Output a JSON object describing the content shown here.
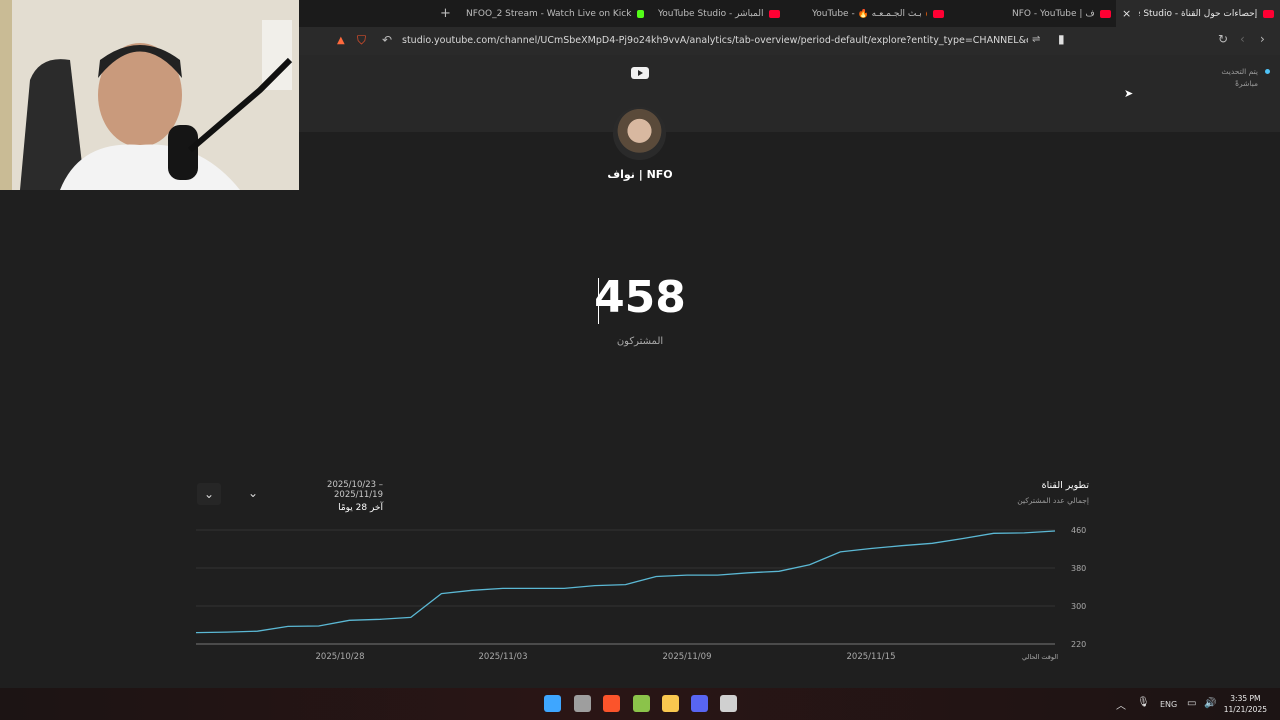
{
  "browser": {
    "tabs": [
      {
        "title": "NFOO_2 Stream - Watch Live on Kick",
        "fav_color": "#53fc18"
      },
      {
        "title": "YouTube Studio - البث المباشر",
        "fav_color": "#ff0033"
      },
      {
        "title": "YouTube - 🔥 بـث الجـمـعـه 🔥",
        "fav_color": "#ff0033"
      },
      {
        "title": "NFO - YouTube | نواف",
        "fav_color": "#ff0033"
      },
      {
        "title": "إحصاءات حول القناة - YouTube Studio",
        "fav_color": "#ff0033"
      }
    ],
    "new_tab_label": "+",
    "close_tab_label": "×",
    "url": "studio.youtube.com/channel/UCmSbeXMpD4-Pj9o24kh9vvA/analytics/tab-overview/period-default/explore?entity_type=CHANNEL&entity_id=UCmS..."
  },
  "header": {
    "live_status_line1": "يتم التحديث",
    "live_status_line2": "مباشرةً"
  },
  "channel": {
    "name": "نواف | NFO",
    "subscriber_count": "458",
    "subscriber_label": "المشتركون"
  },
  "chart_section": {
    "date_range": "2025/10/23 – 2025/11/19",
    "period_label": "آخر 28 يومًا",
    "title": "تطوير القناة",
    "subtitle": "إجمالي عدد المشتركين"
  },
  "chart_data": {
    "type": "line",
    "title": "تطوير القناة",
    "ylabel": "إجمالي عدد المشتركين",
    "ylim": [
      220,
      460
    ],
    "y_ticks": [
      "460",
      "380",
      "300",
      "220"
    ],
    "x_tick_labels": [
      "2025/10/28",
      "2025/11/03",
      "2025/11/09",
      "2025/11/15",
      "الوقت الحالي"
    ],
    "line_color": "#5bb8d4",
    "series": [
      {
        "values": [
          244,
          245,
          247,
          257,
          258,
          270,
          272,
          276,
          326,
          333,
          337,
          337,
          337,
          343,
          345,
          362,
          365,
          365,
          370,
          373,
          387,
          414,
          421,
          427,
          432,
          442,
          453,
          454,
          458
        ]
      }
    ]
  },
  "taskbar": {
    "language": "ENG",
    "time": "3:35 PM",
    "date": "11/21/2025",
    "apps": [
      {
        "name": "start-button",
        "color": "#3ea6ff"
      },
      {
        "name": "task-view",
        "color": "#9e9e9e"
      },
      {
        "name": "brave-browser",
        "color": "#fb542b"
      },
      {
        "name": "app-green",
        "color": "#8bc34a"
      },
      {
        "name": "file-explorer",
        "color": "#f9c74f"
      },
      {
        "name": "discord",
        "color": "#5865f2"
      },
      {
        "name": "obs",
        "color": "#d0d0d0"
      }
    ]
  }
}
